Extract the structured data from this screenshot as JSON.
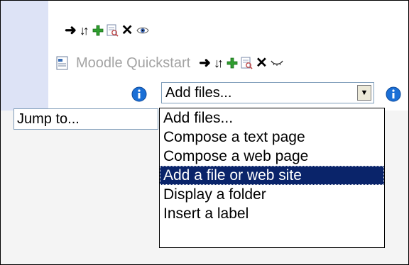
{
  "course_block": {
    "section_tools": [
      "move-arrow-icon",
      "move-updown-icon",
      "add-icon",
      "edit-icon",
      "delete-icon",
      "visibility-eye-icon"
    ],
    "resource": {
      "name": "Moodle Quickstart",
      "icon": "document-icon",
      "tools": [
        "move-arrow-icon",
        "move-updown-icon",
        "add-icon",
        "edit-icon",
        "delete-icon",
        "hidden-eye-icon"
      ]
    },
    "add_resource_select": {
      "value": "Add files...",
      "options": [
        "Add files...",
        "Compose a text page",
        "Compose a web page",
        "Add a file or web site",
        "Display a folder",
        "Insert a label"
      ],
      "highlighted_index": 3
    }
  },
  "jump_to": {
    "value": "Jump to..."
  },
  "colors": {
    "selection": "#0a246a",
    "left_band": "#dde3f6",
    "muted_text": "#a3a3a3",
    "info_blue": "#1a6fd6"
  }
}
